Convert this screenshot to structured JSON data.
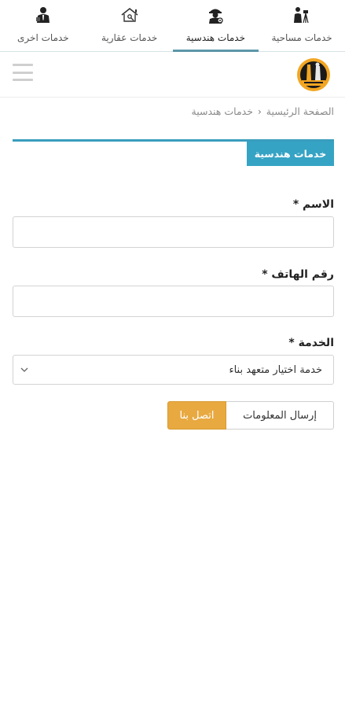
{
  "tabs": [
    {
      "label": "خدمات مساحية",
      "icon": "surveyor-icon",
      "active": false
    },
    {
      "label": "خدمات هندسية",
      "icon": "engineer-icon",
      "active": true
    },
    {
      "label": "خدمات عقارية",
      "icon": "house-key-icon",
      "active": false
    },
    {
      "label": "خدمات اخرى",
      "icon": "businessman-icon",
      "active": false
    }
  ],
  "header": {
    "logo": "company-logo",
    "menu_icon": "hamburger-menu-icon"
  },
  "breadcrumb": {
    "home": "الصفحة الرئيسية",
    "separator": "›",
    "current": "خدمات هندسية"
  },
  "section": {
    "title": "خدمات هندسية"
  },
  "form": {
    "name_label": "الاسم *",
    "phone_label": "رقم الهاتف *",
    "service_label": "الخدمة *",
    "service_selected": "خدمة اختيار متعهد بناء",
    "name_value": "",
    "phone_value": ""
  },
  "buttons": {
    "contact": "اتصل بنا",
    "submit": "إرسال المعلومات"
  },
  "colors": {
    "accent": "#35a3c4",
    "tab_indicator": "#5b97a8",
    "contact_button": "#e8a941"
  }
}
